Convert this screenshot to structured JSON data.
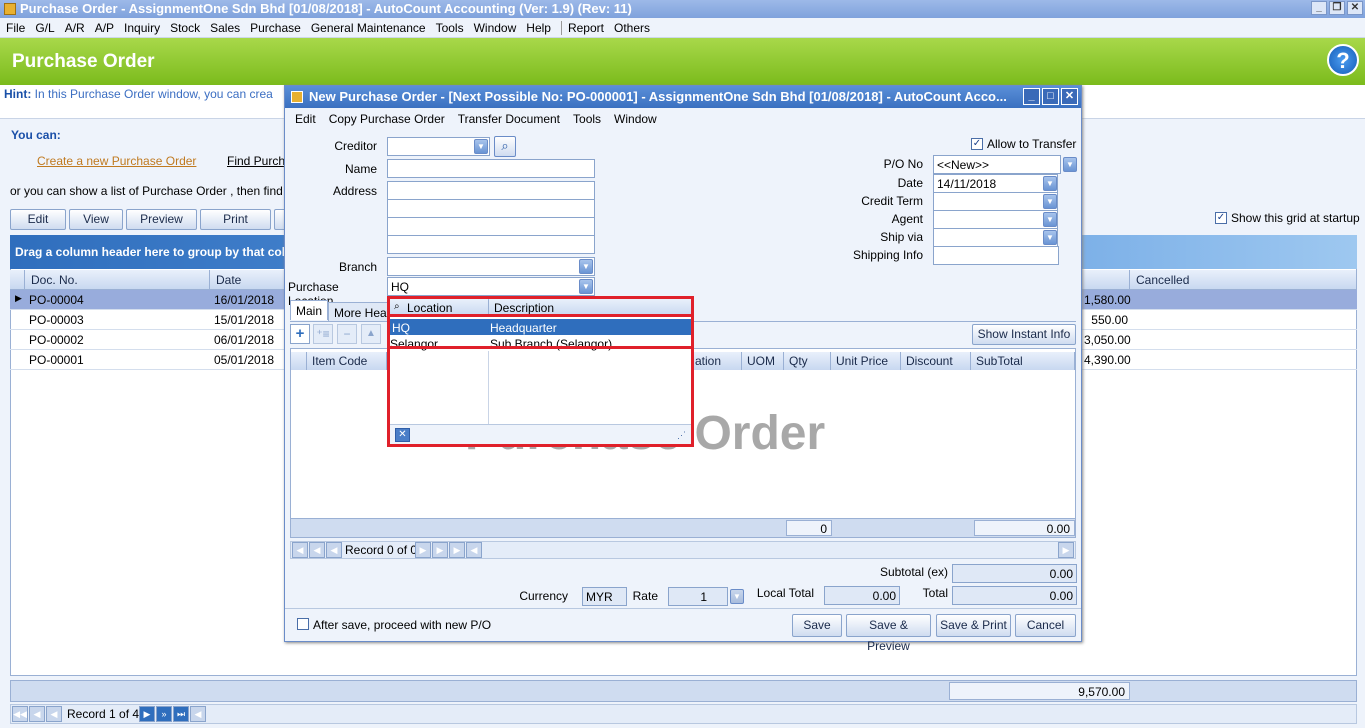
{
  "window": {
    "title": "Purchase Order - AssignmentOne Sdn Bhd [01/08/2018] - AutoCount Accounting (Ver: 1.9) (Rev: 11)"
  },
  "menu": [
    "File",
    "G/L",
    "A/R",
    "A/P",
    "Inquiry",
    "Stock",
    "Sales",
    "Purchase",
    "General Maintenance",
    "Tools",
    "Window",
    "Help",
    "Report",
    "Others"
  ],
  "header": {
    "title": "Purchase Order"
  },
  "hint": {
    "label": "Hint:",
    "text": "In this Purchase Order window, you can crea"
  },
  "youcan": {
    "title": "You can:",
    "create_link": "Create a new Purchase Order",
    "find_link": "Find Purcha",
    "or_text": "or you can show a  list of Purchase Order , then find you"
  },
  "toolbar": {
    "edit": "Edit",
    "view": "View",
    "preview": "Preview",
    "print": "Print",
    "show_grid": "Show this grid at startup"
  },
  "grid": {
    "group_hint": "Drag a column header here to group by that col",
    "columns": [
      "Doc. No.",
      "Date",
      "Cancelled"
    ],
    "rows": [
      {
        "doc": "PO-00004",
        "date": "16/01/2018",
        "amount": "1,580.00"
      },
      {
        "doc": "PO-00003",
        "date": "15/01/2018",
        "amount": "550.00"
      },
      {
        "doc": "PO-00002",
        "date": "06/01/2018",
        "amount": "3,050.00"
      },
      {
        "doc": "PO-00001",
        "date": "05/01/2018",
        "amount": "4,390.00"
      }
    ],
    "total": "9,570.00",
    "record": "Record 1 of 4"
  },
  "dialog": {
    "title": "New Purchase Order - [Next Possible No: PO-000001] - AssignmentOne Sdn Bhd [01/08/2018] - AutoCount Acco...",
    "menu": [
      "Edit",
      "Copy Purchase Order",
      "Transfer Document",
      "Tools",
      "Window"
    ],
    "labels": {
      "creditor": "Creditor",
      "name": "Name",
      "address": "Address",
      "branch": "Branch",
      "purchase_location": "Purchase Location",
      "allow_transfer": "Allow to Transfer",
      "po_no": "P/O  No",
      "date": "Date",
      "credit_term": "Credit Term",
      "agent": "Agent",
      "ship_via": "Ship via",
      "shipping_info": "Shipping Info"
    },
    "values": {
      "purchase_location": "HQ",
      "po_no": "<<New>>",
      "date": "14/11/2018"
    },
    "tabs": [
      "Main",
      "More Heade"
    ],
    "show_instant_info": "Show Instant Info",
    "item_columns": [
      "Item Code",
      "ation",
      "UOM",
      "Qty",
      "Unit Price",
      "Discount",
      "SubTotal"
    ],
    "watermark": "Purchase Order",
    "grid_qty_total": "0",
    "grid_subtotal": "0.00",
    "record": "Record 0 of 0",
    "subtotal_label": "Subtotal (ex)",
    "subtotal": "0.00",
    "currency_label": "Currency",
    "currency": "MYR",
    "rate_label": "Rate",
    "rate": "1",
    "local_total_label": "Local Total",
    "local_total": "0.00",
    "total_label": "Total",
    "total": "0.00",
    "after_save": "After save, proceed with new P/O",
    "buttons": {
      "save": "Save",
      "save_preview": "Save & Preview",
      "save_print": "Save & Print",
      "cancel": "Cancel"
    }
  },
  "location_popup": {
    "columns": [
      "Location",
      "Description"
    ],
    "rows": [
      {
        "location": "HQ",
        "description": "Headquarter"
      },
      {
        "location": "Selangor",
        "description": "Sub Branch (Selangor)"
      }
    ]
  },
  "colors": {
    "accent": "#7bbb1c",
    "selection": "#2f6ebd",
    "highlight": "#e0202a"
  }
}
